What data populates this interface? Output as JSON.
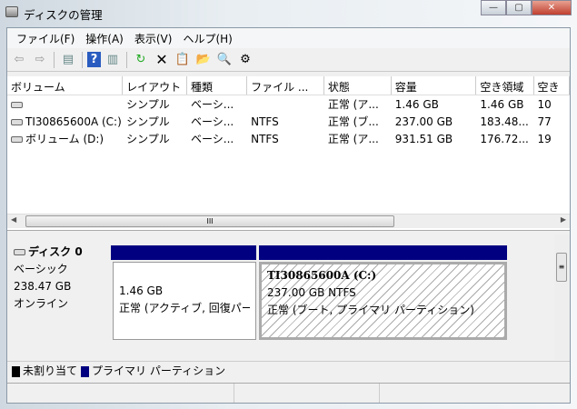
{
  "window": {
    "title": "ディスクの管理",
    "minimize": "—",
    "maximize": "▢",
    "close": "✕"
  },
  "menu": [
    "ファイル(F)",
    "操作(A)",
    "表示(V)",
    "ヘルプ(H)"
  ],
  "columns": [
    "ボリューム",
    "レイアウト",
    "種類",
    "ファイル ...",
    "状態",
    "容量",
    "空き領域",
    "空き"
  ],
  "rows": [
    [
      "",
      "シンプル",
      "ベーシ...",
      "",
      "正常 (ア...",
      "1.46 GB",
      "1.46 GB",
      "10"
    ],
    [
      "TI30865600A (C:)",
      "シンプル",
      "ベーシ...",
      "NTFS",
      "正常 (ブ...",
      "237.00 GB",
      "183.48...",
      "77"
    ],
    [
      "ボリューム (D:)",
      "シンプル",
      "ベーシ...",
      "NTFS",
      "正常 (ア...",
      "931.51 GB",
      "176.72...",
      "19"
    ]
  ],
  "disk": {
    "name": "ディスク 0",
    "type": "ベーシック",
    "size": "238.47 GB",
    "status": "オンライン",
    "partitions": [
      {
        "name": "",
        "size": "1.46 GB",
        "status": "正常 (アクティブ, 回復パー"
      },
      {
        "name": "TI30865600A  (C:)",
        "size": "237.00 GB NTFS",
        "status": "正常 (ブート, プライマリ パーティション)"
      }
    ]
  },
  "legend": [
    {
      "label": "未割り当て",
      "color": "#000000"
    },
    {
      "label": "プライマリ パーティション",
      "color": "#000080"
    }
  ],
  "scroll_glyph": "III"
}
